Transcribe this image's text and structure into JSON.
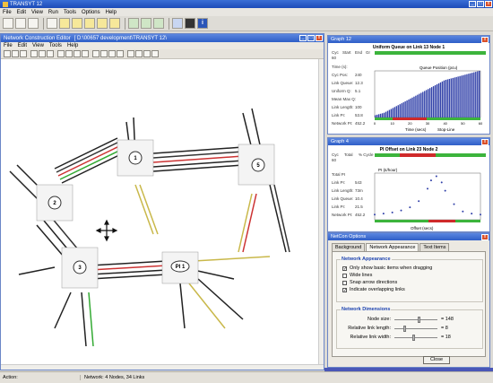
{
  "app": {
    "title": "TRANSYT 12"
  },
  "menubar": {
    "items": [
      "File",
      "Edit",
      "View",
      "Run",
      "Tools",
      "Options",
      "Help"
    ]
  },
  "editor": {
    "title": "Network Construction Editor",
    "path": "[ D:\\00657 development\\TRANSYT 12\\",
    "menu": [
      "File",
      "Edit",
      "View",
      "Tools",
      "Help"
    ]
  },
  "network": {
    "node_labels": [
      "1",
      "2",
      "3",
      "5",
      "PI 1"
    ]
  },
  "graph12": {
    "title": "Graph 12",
    "chart_title": "Uniform Queue on Link 13 Node 1",
    "header_row": [
      "Cyc",
      "Start",
      "End",
      "Gr"
    ],
    "header_vals": [
      "60",
      "",
      "",
      ""
    ],
    "labels": [
      "Time (s):",
      "Cyc Pos:",
      "Link Queue:",
      "Uniform Q:",
      "Mean Max Q:",
      "Link Length:",
      "Link PI:",
      "Network PI:"
    ],
    "values": [
      "",
      "240",
      "12.3",
      "5.1",
      "",
      "100",
      "53.8",
      "452.2"
    ],
    "ylabel": "Queue Position (pcu)",
    "xlabel": "Time (secs)",
    "legend": "Stop-Line",
    "xticks": [
      "0",
      "10",
      "20",
      "30",
      "40",
      "50",
      "60"
    ],
    "chart_data": {
      "type": "bar",
      "title": "Uniform Queue on Link 13 Node 1",
      "xlabel": "Time (secs)",
      "ylabel": "Queue Position (pcu)",
      "categories": [
        "0",
        "5",
        "10",
        "15",
        "20",
        "25",
        "30",
        "35",
        "40",
        "45",
        "50",
        "55",
        "60"
      ],
      "values": [
        0.5,
        1,
        2,
        3,
        4,
        5,
        6,
        7,
        8,
        8.5,
        9,
        9.5,
        10
      ],
      "ylim": [
        0,
        10
      ]
    }
  },
  "graph4": {
    "title": "Graph 4",
    "chart_title": "PI Offset on Link 23 Node 2",
    "header_row": [
      "Cyc",
      "Total",
      "% Cycle"
    ],
    "header_vals": [
      "60",
      "",
      ""
    ],
    "labels": [
      "Total PI",
      "Link PI:",
      "Link Length:",
      "Link Queue:",
      "Link PI:",
      "Network PI:"
    ],
    "values": [
      "",
      "543",
      "73m",
      "10.4",
      "21.5",
      "452.2"
    ],
    "ylabel": "PI (£/hour)",
    "xlabel": "Offset (secs)",
    "chart_data": {
      "type": "scatter",
      "title": "PI Offset on Link 23 Node 2",
      "xlabel": "Offset (secs)",
      "ylabel": "PI (£/hour)",
      "x": [
        0,
        5,
        10,
        15,
        20,
        25,
        30,
        32,
        35,
        38,
        40,
        45,
        50,
        55,
        60
      ],
      "y": [
        5,
        6,
        7,
        9,
        12,
        18,
        30,
        38,
        42,
        36,
        28,
        15,
        8,
        6,
        5
      ]
    }
  },
  "netcon": {
    "title": "NetCon Options",
    "tabs": [
      "Background",
      "Network Appearance",
      "Text Items"
    ],
    "appearance_group": "Network Appearance",
    "checks": [
      {
        "label": "Only show basic items when dragging",
        "checked": true
      },
      {
        "label": "Wide lines",
        "checked": false
      },
      {
        "label": "Snap arrow directions",
        "checked": false
      },
      {
        "label": "Indicate overlapping links",
        "checked": true
      }
    ],
    "dimensions_group": "Network Dimensions",
    "sliders": [
      {
        "label": "Node size:",
        "value": "= 148"
      },
      {
        "label": "Relative link length:",
        "value": "= 8"
      },
      {
        "label": "Relative link width:",
        "value": "= 18"
      }
    ],
    "close_label": "Close"
  },
  "status": {
    "action": "Action:",
    "network": "Network: 4 Nodes, 34 Links"
  }
}
